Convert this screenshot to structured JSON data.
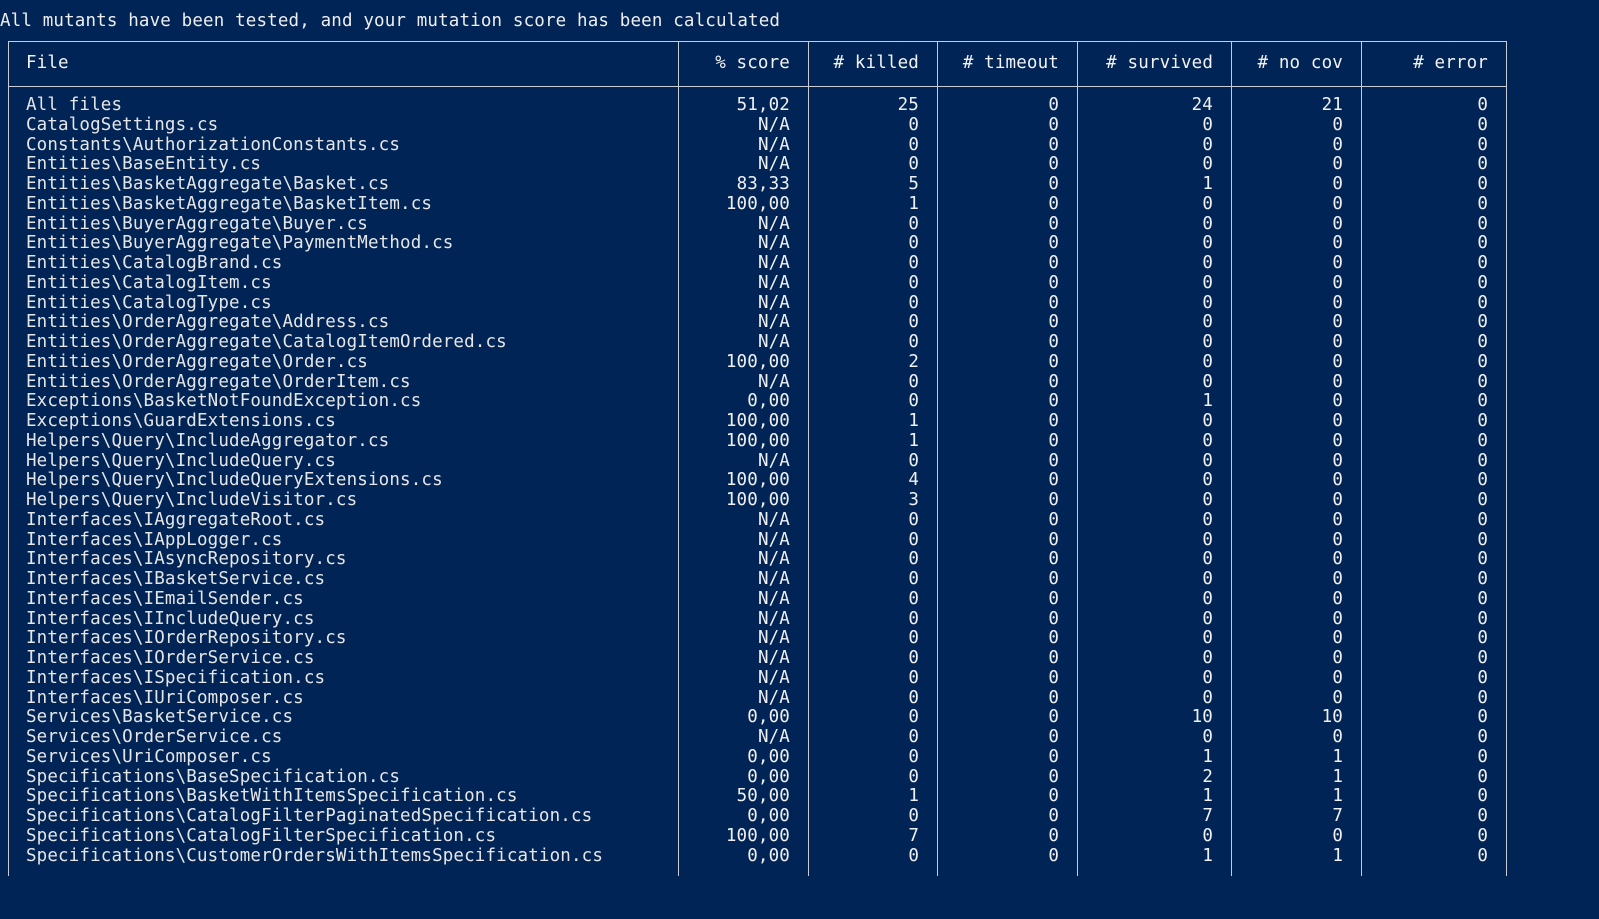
{
  "console": {
    "status_line": "All mutants have been tested, and your mutation score has been calculated",
    "background_color": "#012456",
    "border_color": "#c9ccd2",
    "text_color": "#e8e8e8"
  },
  "colors": {
    "score_high": "#16c60c",
    "score_low": "#c50f1f",
    "score_na": "#8a8f98"
  },
  "table": {
    "headers": {
      "file": "File",
      "score": "% score",
      "killed": "# killed",
      "timeout": "# timeout",
      "survived": "# survived",
      "nocov": "# no cov",
      "error": "# error"
    },
    "rows": [
      {
        "file": "All files",
        "score": "51,02",
        "score_state": "low",
        "killed": "25",
        "timeout": "0",
        "survived": "24",
        "nocov": "21",
        "error": "0"
      },
      {
        "file": "CatalogSettings.cs",
        "score": "N/A",
        "score_state": "na",
        "killed": "0",
        "timeout": "0",
        "survived": "0",
        "nocov": "0",
        "error": "0"
      },
      {
        "file": "Constants\\AuthorizationConstants.cs",
        "score": "N/A",
        "score_state": "na",
        "killed": "0",
        "timeout": "0",
        "survived": "0",
        "nocov": "0",
        "error": "0"
      },
      {
        "file": "Entities\\BaseEntity.cs",
        "score": "N/A",
        "score_state": "na",
        "killed": "0",
        "timeout": "0",
        "survived": "0",
        "nocov": "0",
        "error": "0"
      },
      {
        "file": "Entities\\BasketAggregate\\Basket.cs",
        "score": "83,33",
        "score_state": "high",
        "killed": "5",
        "timeout": "0",
        "survived": "1",
        "nocov": "0",
        "error": "0"
      },
      {
        "file": "Entities\\BasketAggregate\\BasketItem.cs",
        "score": "100,00",
        "score_state": "high",
        "killed": "1",
        "timeout": "0",
        "survived": "0",
        "nocov": "0",
        "error": "0"
      },
      {
        "file": "Entities\\BuyerAggregate\\Buyer.cs",
        "score": "N/A",
        "score_state": "na",
        "killed": "0",
        "timeout": "0",
        "survived": "0",
        "nocov": "0",
        "error": "0"
      },
      {
        "file": "Entities\\BuyerAggregate\\PaymentMethod.cs",
        "score": "N/A",
        "score_state": "na",
        "killed": "0",
        "timeout": "0",
        "survived": "0",
        "nocov": "0",
        "error": "0"
      },
      {
        "file": "Entities\\CatalogBrand.cs",
        "score": "N/A",
        "score_state": "na",
        "killed": "0",
        "timeout": "0",
        "survived": "0",
        "nocov": "0",
        "error": "0"
      },
      {
        "file": "Entities\\CatalogItem.cs",
        "score": "N/A",
        "score_state": "na",
        "killed": "0",
        "timeout": "0",
        "survived": "0",
        "nocov": "0",
        "error": "0"
      },
      {
        "file": "Entities\\CatalogType.cs",
        "score": "N/A",
        "score_state": "na",
        "killed": "0",
        "timeout": "0",
        "survived": "0",
        "nocov": "0",
        "error": "0"
      },
      {
        "file": "Entities\\OrderAggregate\\Address.cs",
        "score": "N/A",
        "score_state": "na",
        "killed": "0",
        "timeout": "0",
        "survived": "0",
        "nocov": "0",
        "error": "0"
      },
      {
        "file": "Entities\\OrderAggregate\\CatalogItemOrdered.cs",
        "score": "N/A",
        "score_state": "na",
        "killed": "0",
        "timeout": "0",
        "survived": "0",
        "nocov": "0",
        "error": "0"
      },
      {
        "file": "Entities\\OrderAggregate\\Order.cs",
        "score": "100,00",
        "score_state": "high",
        "killed": "2",
        "timeout": "0",
        "survived": "0",
        "nocov": "0",
        "error": "0"
      },
      {
        "file": "Entities\\OrderAggregate\\OrderItem.cs",
        "score": "N/A",
        "score_state": "na",
        "killed": "0",
        "timeout": "0",
        "survived": "0",
        "nocov": "0",
        "error": "0"
      },
      {
        "file": "Exceptions\\BasketNotFoundException.cs",
        "score": "0,00",
        "score_state": "low",
        "killed": "0",
        "timeout": "0",
        "survived": "1",
        "nocov": "0",
        "error": "0"
      },
      {
        "file": "Exceptions\\GuardExtensions.cs",
        "score": "100,00",
        "score_state": "high",
        "killed": "1",
        "timeout": "0",
        "survived": "0",
        "nocov": "0",
        "error": "0"
      },
      {
        "file": "Helpers\\Query\\IncludeAggregator.cs",
        "score": "100,00",
        "score_state": "high",
        "killed": "1",
        "timeout": "0",
        "survived": "0",
        "nocov": "0",
        "error": "0"
      },
      {
        "file": "Helpers\\Query\\IncludeQuery.cs",
        "score": "N/A",
        "score_state": "na",
        "killed": "0",
        "timeout": "0",
        "survived": "0",
        "nocov": "0",
        "error": "0"
      },
      {
        "file": "Helpers\\Query\\IncludeQueryExtensions.cs",
        "score": "100,00",
        "score_state": "high",
        "killed": "4",
        "timeout": "0",
        "survived": "0",
        "nocov": "0",
        "error": "0"
      },
      {
        "file": "Helpers\\Query\\IncludeVisitor.cs",
        "score": "100,00",
        "score_state": "high",
        "killed": "3",
        "timeout": "0",
        "survived": "0",
        "nocov": "0",
        "error": "0"
      },
      {
        "file": "Interfaces\\IAggregateRoot.cs",
        "score": "N/A",
        "score_state": "na",
        "killed": "0",
        "timeout": "0",
        "survived": "0",
        "nocov": "0",
        "error": "0"
      },
      {
        "file": "Interfaces\\IAppLogger.cs",
        "score": "N/A",
        "score_state": "na",
        "killed": "0",
        "timeout": "0",
        "survived": "0",
        "nocov": "0",
        "error": "0"
      },
      {
        "file": "Interfaces\\IAsyncRepository.cs",
        "score": "N/A",
        "score_state": "na",
        "killed": "0",
        "timeout": "0",
        "survived": "0",
        "nocov": "0",
        "error": "0"
      },
      {
        "file": "Interfaces\\IBasketService.cs",
        "score": "N/A",
        "score_state": "na",
        "killed": "0",
        "timeout": "0",
        "survived": "0",
        "nocov": "0",
        "error": "0"
      },
      {
        "file": "Interfaces\\IEmailSender.cs",
        "score": "N/A",
        "score_state": "na",
        "killed": "0",
        "timeout": "0",
        "survived": "0",
        "nocov": "0",
        "error": "0"
      },
      {
        "file": "Interfaces\\IIncludeQuery.cs",
        "score": "N/A",
        "score_state": "na",
        "killed": "0",
        "timeout": "0",
        "survived": "0",
        "nocov": "0",
        "error": "0"
      },
      {
        "file": "Interfaces\\IOrderRepository.cs",
        "score": "N/A",
        "score_state": "na",
        "killed": "0",
        "timeout": "0",
        "survived": "0",
        "nocov": "0",
        "error": "0"
      },
      {
        "file": "Interfaces\\IOrderService.cs",
        "score": "N/A",
        "score_state": "na",
        "killed": "0",
        "timeout": "0",
        "survived": "0",
        "nocov": "0",
        "error": "0"
      },
      {
        "file": "Interfaces\\ISpecification.cs",
        "score": "N/A",
        "score_state": "na",
        "killed": "0",
        "timeout": "0",
        "survived": "0",
        "nocov": "0",
        "error": "0"
      },
      {
        "file": "Interfaces\\IUriComposer.cs",
        "score": "N/A",
        "score_state": "na",
        "killed": "0",
        "timeout": "0",
        "survived": "0",
        "nocov": "0",
        "error": "0"
      },
      {
        "file": "Services\\BasketService.cs",
        "score": "0,00",
        "score_state": "low",
        "killed": "0",
        "timeout": "0",
        "survived": "10",
        "nocov": "10",
        "error": "0"
      },
      {
        "file": "Services\\OrderService.cs",
        "score": "N/A",
        "score_state": "na",
        "killed": "0",
        "timeout": "0",
        "survived": "0",
        "nocov": "0",
        "error": "0"
      },
      {
        "file": "Services\\UriComposer.cs",
        "score": "0,00",
        "score_state": "low",
        "killed": "0",
        "timeout": "0",
        "survived": "1",
        "nocov": "1",
        "error": "0"
      },
      {
        "file": "Specifications\\BaseSpecification.cs",
        "score": "0,00",
        "score_state": "low",
        "killed": "0",
        "timeout": "0",
        "survived": "2",
        "nocov": "1",
        "error": "0"
      },
      {
        "file": "Specifications\\BasketWithItemsSpecification.cs",
        "score": "50,00",
        "score_state": "low",
        "killed": "1",
        "timeout": "0",
        "survived": "1",
        "nocov": "1",
        "error": "0"
      },
      {
        "file": "Specifications\\CatalogFilterPaginatedSpecification.cs",
        "score": "0,00",
        "score_state": "low",
        "killed": "0",
        "timeout": "0",
        "survived": "7",
        "nocov": "7",
        "error": "0"
      },
      {
        "file": "Specifications\\CatalogFilterSpecification.cs",
        "score": "100,00",
        "score_state": "high",
        "killed": "7",
        "timeout": "0",
        "survived": "0",
        "nocov": "0",
        "error": "0"
      },
      {
        "file": "Specifications\\CustomerOrdersWithItemsSpecification.cs",
        "score": "0,00",
        "score_state": "low",
        "killed": "0",
        "timeout": "0",
        "survived": "1",
        "nocov": "1",
        "error": "0"
      }
    ]
  }
}
